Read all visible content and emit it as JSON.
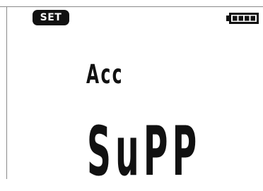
{
  "status_bar": {
    "mode_badge": "SET",
    "battery": {
      "icon": "battery-icon",
      "level": 1.0
    }
  },
  "display": {
    "line1": "Acc",
    "line2": "SuPP"
  },
  "colors": {
    "segment": "#111111",
    "background": "#ffffff",
    "frame": "#8a8a8a"
  }
}
